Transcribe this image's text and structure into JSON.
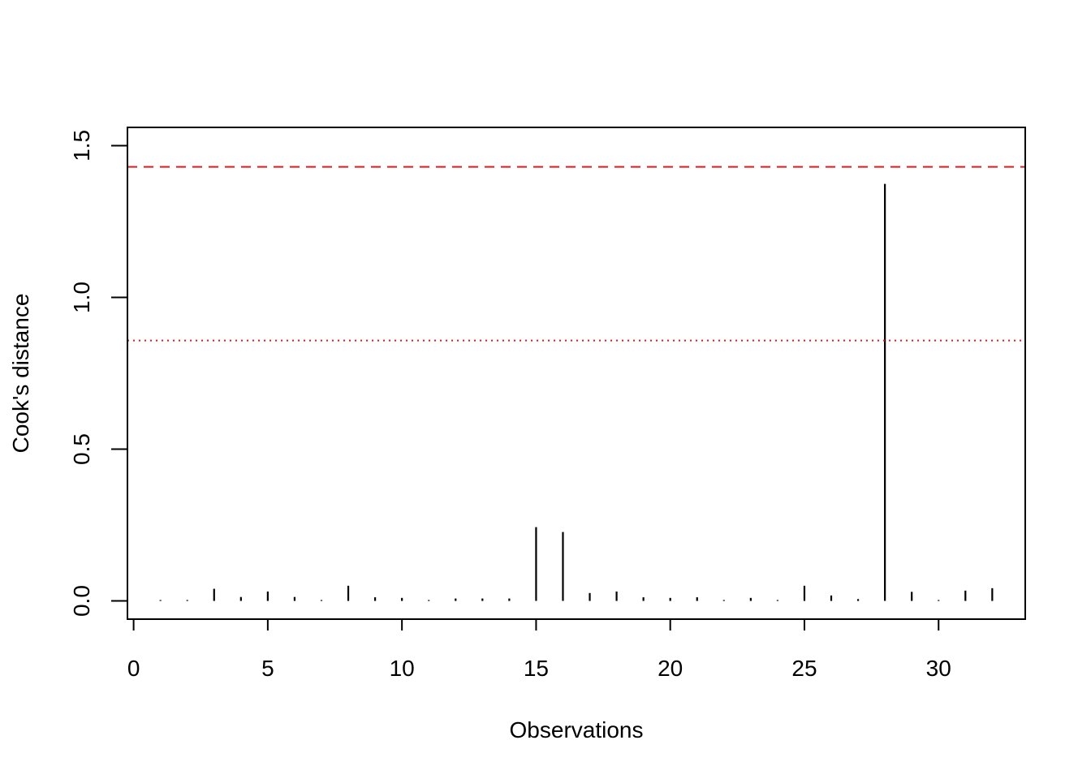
{
  "chart_data": {
    "type": "bar",
    "subtype": "histogram-spikes",
    "title": "",
    "xlabel": "Observations",
    "ylabel": "Cook's distance",
    "xlim": [
      -0.23,
      33.23
    ],
    "ylim": [
      -0.06,
      1.56
    ],
    "x_ticks": [
      0,
      5,
      10,
      15,
      20,
      25,
      30
    ],
    "x_tick_labels": [
      "0",
      "5",
      "10",
      "15",
      "20",
      "25",
      "30"
    ],
    "y_ticks": [
      0.0,
      0.5,
      1.0,
      1.5
    ],
    "y_tick_labels": [
      "0.0",
      "0.5",
      "1.0",
      "1.5"
    ],
    "grid": false,
    "x": [
      1,
      2,
      3,
      4,
      5,
      6,
      7,
      8,
      9,
      10,
      11,
      12,
      13,
      14,
      15,
      16,
      17,
      18,
      19,
      20,
      21,
      22,
      23,
      24,
      25,
      26,
      27,
      28,
      29,
      30,
      31,
      32
    ],
    "values": [
      0.003,
      0.003,
      0.04,
      0.013,
      0.031,
      0.013,
      0.003,
      0.05,
      0.012,
      0.01,
      0.003,
      0.008,
      0.008,
      0.008,
      0.243,
      0.227,
      0.026,
      0.031,
      0.012,
      0.01,
      0.012,
      0.003,
      0.01,
      0.003,
      0.05,
      0.018,
      0.006,
      1.374,
      0.03,
      0.003,
      0.034,
      0.042
    ],
    "reference_lines": [
      {
        "name": "upper-threshold",
        "value": 1.43,
        "style": "dashed",
        "color": "#e31a1c"
      },
      {
        "name": "lower-threshold",
        "value": 0.858,
        "style": "dotted",
        "color": "#e31a1c"
      }
    ],
    "series_color": "#000000"
  }
}
